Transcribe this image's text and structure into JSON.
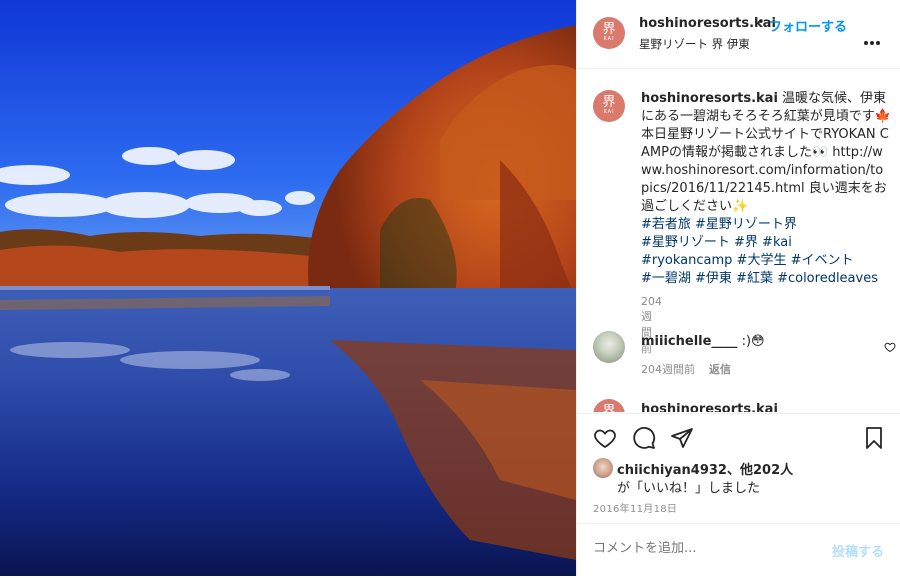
{
  "post": {
    "image_alt": "autumn lake photo"
  },
  "header": {
    "avatar_glyph": "界",
    "avatar_sub": "KAI",
    "username": "hoshinoresorts.kai",
    "separator": "•",
    "follow_label": "フォローする",
    "location": "星野リゾート 界 伊東",
    "more_icon": "more-horizontal-icon"
  },
  "caption": {
    "username": "hoshinoresorts.kai",
    "text_1": "温暖な気候、伊東にある一碧湖もそろそろ紅葉が見頃です🍁本日星野リゾート公式サイトでRYOKAN CAMPの情報が掲載されました👀 http://www.hoshinoresort.com/information/topics/2016/11/22145.html 良い週末をお過ごしください✨",
    "tags_line_1": "#若者旅 #星野リゾート界",
    "tags_line_2": "#星野リゾート #界 #kai",
    "tags_line_3": "#ryokancamp #大学生 #イベント",
    "tags_line_4": "#一碧湖 #伊東 #紅葉 #coloredleaves",
    "time": "204週間前"
  },
  "comment_1": {
    "username": "miiichelle____",
    "text": ":)😳",
    "time": "204週間前",
    "reply_label": "返信"
  },
  "comment_2": {
    "username": "hoshinoresorts.kai"
  },
  "likes": {
    "line_1_user": "chiichiyan4932",
    "line_1_rest": "、他202人",
    "line_2": "が「いいね！」しました"
  },
  "date": "2016年11月18日",
  "add_comment": {
    "placeholder": "コメントを追加...",
    "post_label": "投稿する"
  },
  "colors": {
    "link_blue": "#0095f6",
    "post_disabled": "#b2dffc",
    "tag_blue": "#00376b",
    "muted": "#8e8e8e"
  }
}
